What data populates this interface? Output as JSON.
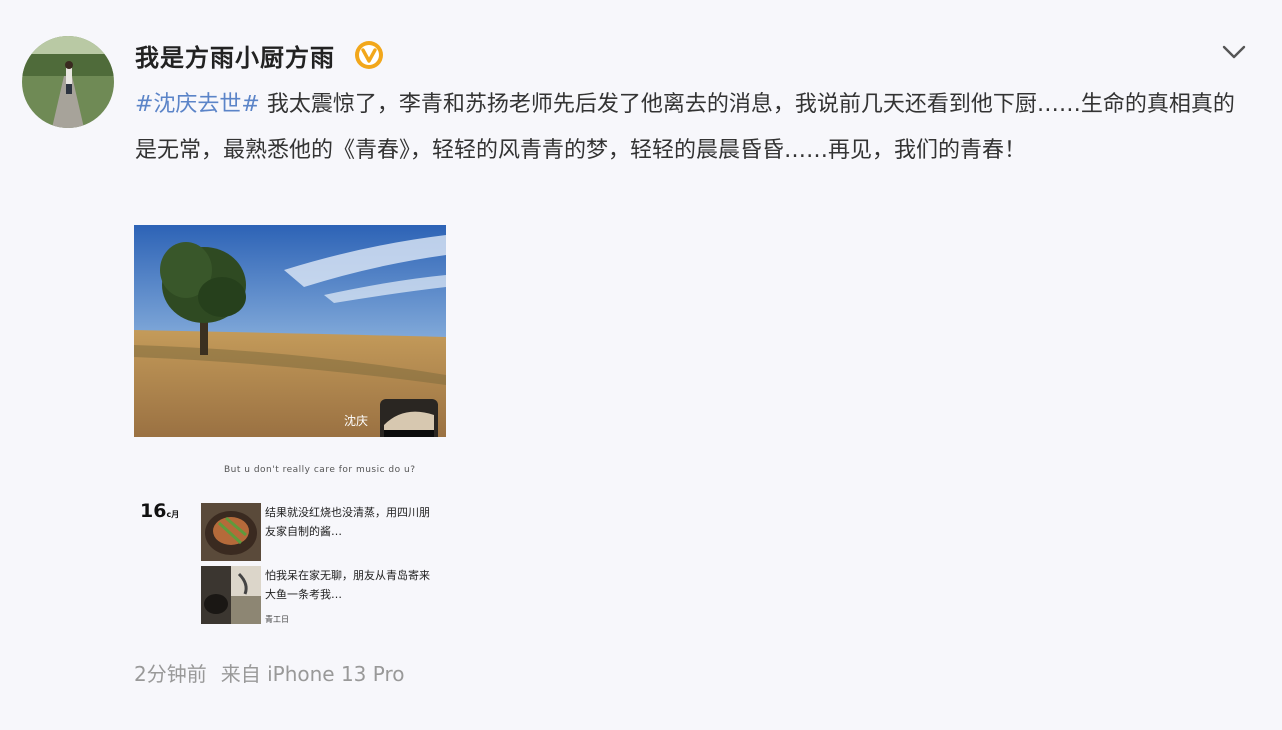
{
  "post": {
    "author": "我是方雨小厨方雨",
    "hashtag": "#沈庆去世#",
    "text_parts": [
      " 我太震惊了，李青和苏扬老师先后发了他离去的消息，我说前几天还看到他下厨……生命的真相真的是无常，最熟悉他的《青春》，轻轻的风青青的梦，轻轻的晨晨昏昏……再见，我们的青春！"
    ],
    "time": "2分钟前",
    "source": "来自 iPhone 13 Pro"
  },
  "screenshot": {
    "watermark": "沈庆",
    "caption": "But u don't really care for music do u?",
    "mini_date": "16",
    "mini_date_unit": "c月",
    "item1_text": "结果就没红烧也没清蒸，用四川朋友家自制的酱…",
    "item2_text": "怕我呆在家无聊，朋友从青岛寄来大鱼一条考我…",
    "item_footer": "青工日"
  },
  "icons": {
    "verified": "verified-badge-icon",
    "menu": "chevron-down-icon"
  },
  "colors": {
    "hashtag": "#5b84c8",
    "verified": "#f2a71b",
    "meta": "#999999"
  }
}
